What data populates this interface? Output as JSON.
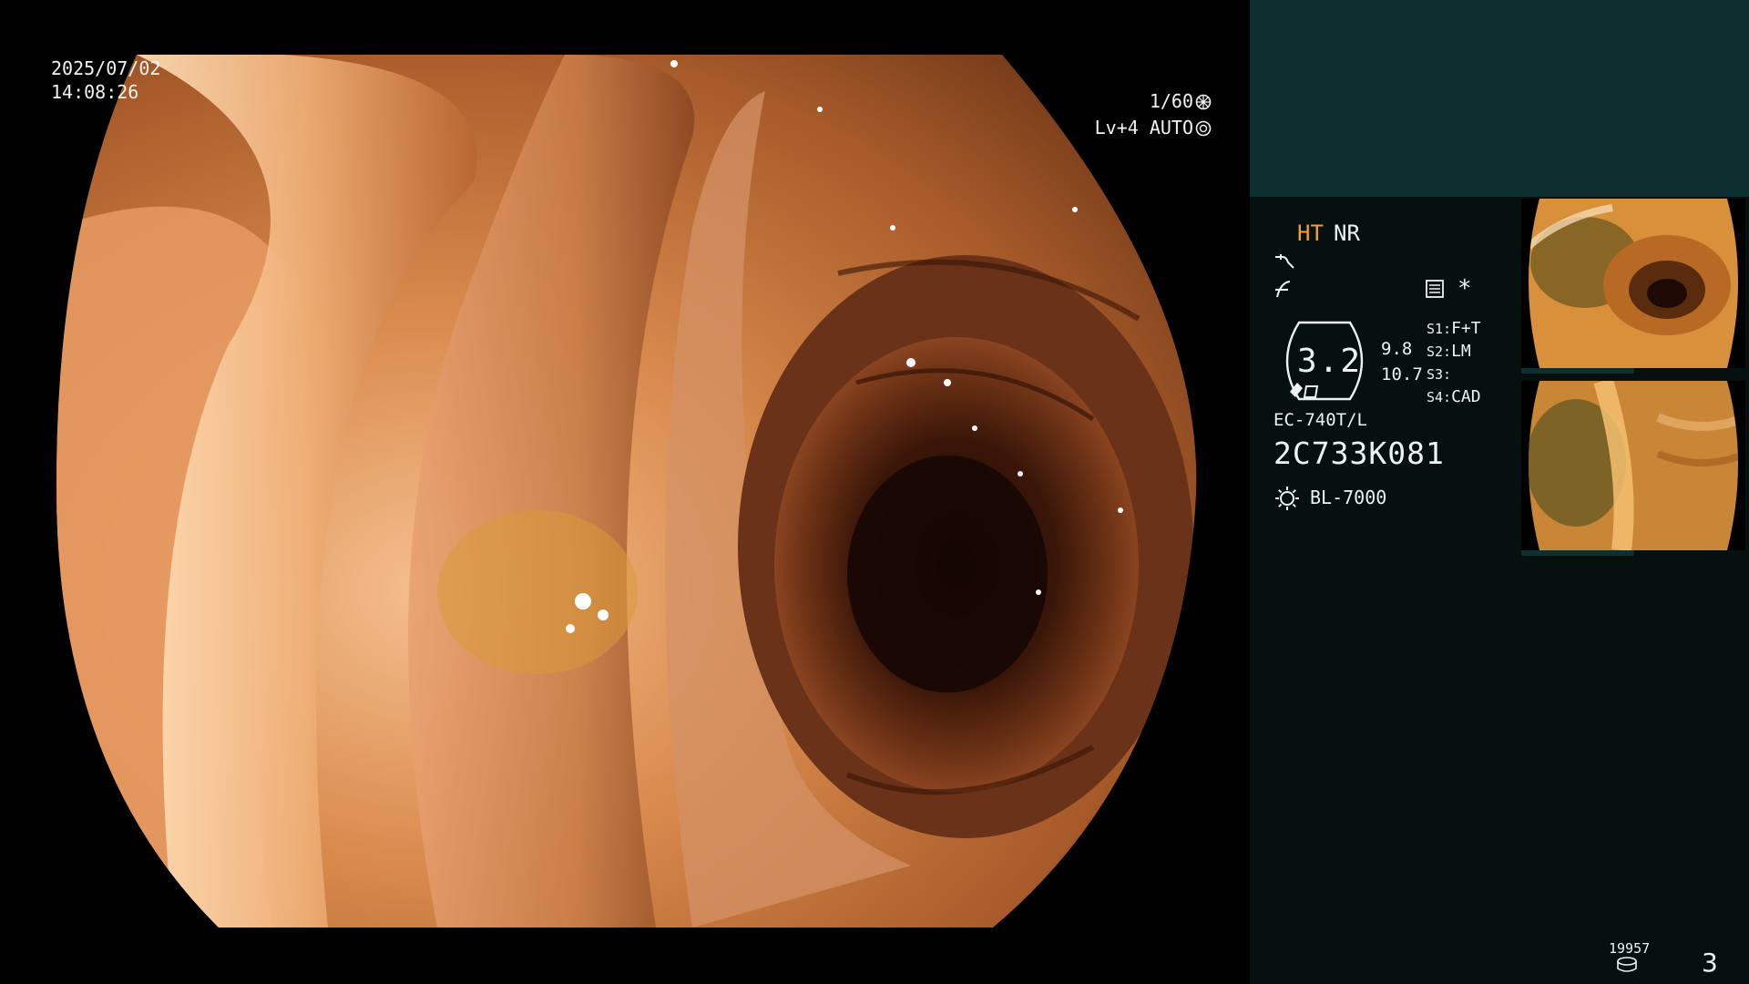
{
  "osd": {
    "date": "2025/07/02",
    "time": "14:08:26",
    "shutter": "1/60",
    "level": "Lv+4 AUTO"
  },
  "panel": {
    "mode_ht": "HT",
    "mode_nr": "NR",
    "star": "*",
    "zoom_value": "3.2",
    "value_a": "9.8",
    "value_b": "10.7",
    "slots": [
      {
        "key": "S1:",
        "value": "F+T"
      },
      {
        "key": "S2:",
        "value": "LM"
      },
      {
        "key": "S3:",
        "value": ""
      },
      {
        "key": "S4:",
        "value": "CAD"
      }
    ],
    "scope_model": "EC-740T/L",
    "scope_serial": "2C733K081",
    "light_source": "BL-7000"
  },
  "footer": {
    "counter": "19957",
    "page_number": "3"
  },
  "colors": {
    "panel_top": "#0e2f2f",
    "panel_body": "#06100f",
    "accent_ht": "#f0a030",
    "mucosa": "#c87840"
  },
  "icons": {
    "shutter": "shutter-icon",
    "auto": "auto-iris-icon",
    "curve1": "edge-curve-icon",
    "curve2": "enhance-curve-icon",
    "list": "menu-list-icon",
    "light": "light-source-icon",
    "counter": "storage-icon"
  }
}
